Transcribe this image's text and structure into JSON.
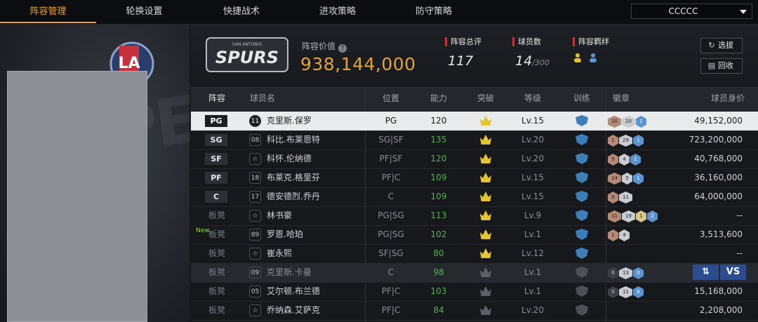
{
  "tabs": [
    {
      "label": "阵容管理",
      "active": true
    },
    {
      "label": "轮换设置",
      "active": false
    },
    {
      "label": "快捷战术",
      "active": false
    },
    {
      "label": "进攻策略",
      "active": false
    },
    {
      "label": "防守策略",
      "active": false
    }
  ],
  "team_select": {
    "value": "CCCCC"
  },
  "header": {
    "lineup_value_label": "阵容价值",
    "lineup_value": "938,144,000",
    "overall_label": "阵容总评",
    "overall_value": "117",
    "players_label": "球员数",
    "players_value": "14",
    "players_max": "/300",
    "bond_label": "阵容羁绊",
    "bond_icons": [
      "gold-people-icon",
      "blue-people-icon"
    ],
    "logo_text": "SAN ANTONIO SPURS",
    "logo_display_text": "SPURS",
    "logo_arc_text": "SAN ANTONIO"
  },
  "buttons": {
    "select_label": "选拔",
    "recycle_label": "回收"
  },
  "columns": [
    "阵容",
    "球员名",
    "位置",
    "能力",
    "突破",
    "等级",
    "训练",
    "徽章",
    "球员身价"
  ],
  "rows": [
    {
      "slot": "PG",
      "number": "11",
      "name": "克里斯.保罗",
      "position": "PG",
      "ability": "120",
      "level": "Lv.15",
      "badges": [
        {
          "v": "10",
          "t": "bronze"
        },
        {
          "v": "20",
          "t": "silver"
        },
        {
          "v": "1",
          "t": "blue"
        }
      ],
      "salary": "49,152,000"
    },
    {
      "slot": "SG",
      "number": "08",
      "name": "科比.布莱恩特",
      "position": "SG|SF",
      "ability": "135",
      "level": "Lv.20",
      "badges": [
        {
          "v": "1",
          "t": "bronze"
        },
        {
          "v": "29",
          "t": "silver"
        },
        {
          "v": "1",
          "t": "blue"
        }
      ],
      "salary": "723,200,000"
    },
    {
      "slot": "SF",
      "number": "",
      "name": "科怀.伦纳德",
      "position": "PF|SF",
      "ability": "120",
      "level": "Lv.20",
      "badges": [
        {
          "v": "9",
          "t": "bronze"
        },
        {
          "v": "4",
          "t": "silver"
        },
        {
          "v": "1",
          "t": "blue"
        }
      ],
      "salary": "40,768,000"
    },
    {
      "slot": "PF",
      "number": "18",
      "name": "布莱克.格里芬",
      "position": "PF|C",
      "ability": "109",
      "level": "Lv.15",
      "badges": [
        {
          "v": "14",
          "t": "bronze"
        },
        {
          "v": "5",
          "t": "silver"
        },
        {
          "v": "1",
          "t": "blue"
        }
      ],
      "salary": "36,160,000"
    },
    {
      "slot": "C",
      "number": "17",
      "name": "德安德烈.乔丹",
      "position": "C",
      "ability": "109",
      "level": "Lv.15",
      "badges": [
        {
          "v": "0",
          "t": "bronze"
        },
        {
          "v": "11",
          "t": "silver"
        }
      ],
      "salary": "64,000,000"
    },
    {
      "slot": "板凳",
      "number": "",
      "name": "林书豪",
      "position": "PG|SG",
      "ability": "113",
      "level": "Lv.9",
      "badges": [
        {
          "v": "11",
          "t": "bronze"
        },
        {
          "v": "19",
          "t": "silver"
        },
        {
          "v": "1",
          "t": "gold"
        },
        {
          "v": "2",
          "t": "blue"
        }
      ],
      "salary": "--"
    },
    {
      "slot": "板凳",
      "new_label": "New",
      "number": "89",
      "name": "罗恩.哈珀",
      "position": "PG|SG",
      "ability": "102",
      "level": "Lv.1",
      "badges": [
        {
          "v": "1",
          "t": "bronze"
        },
        {
          "v": "4",
          "t": "silver"
        }
      ],
      "salary": "3,513,600"
    },
    {
      "slot": "板凳",
      "number": "",
      "name": "崔永熙",
      "position": "SF|SG",
      "ability": "80",
      "level": "Lv.12",
      "badges": [],
      "salary": "--"
    },
    {
      "slot": "板凳",
      "number": "09",
      "name": "克里斯.卡曼",
      "position": "C",
      "ability": "98",
      "level": "Lv.1",
      "badges": [
        {
          "v": "0",
          "t": "dark"
        },
        {
          "v": "13",
          "t": "silver"
        },
        {
          "v": "0",
          "t": "blue"
        }
      ],
      "salary": "",
      "dim": true
    },
    {
      "slot": "板凳",
      "number": "05",
      "name": "艾尔顿.布兰德",
      "position": "PF|C",
      "ability": "103",
      "level": "Lv.1",
      "badges": [
        {
          "v": "0",
          "t": "dark"
        },
        {
          "v": "11",
          "t": "silver"
        },
        {
          "v": "0",
          "t": "blue"
        }
      ],
      "salary": "15,168,000"
    },
    {
      "slot": "板凳",
      "number": "",
      "name": "乔纳森.艾萨克",
      "position": "PF|C",
      "ability": "84",
      "level": "Lv.20",
      "badges": [],
      "salary": "2,208,000"
    }
  ],
  "row_actions": {
    "swap_label": "⇅",
    "vs_label": "VS"
  }
}
